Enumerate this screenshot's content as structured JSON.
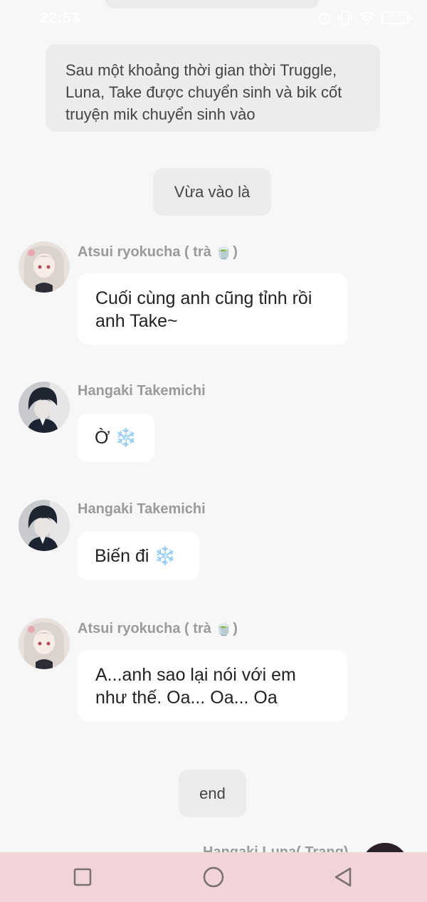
{
  "status_bar": {
    "time": "22:53",
    "icons": [
      "alarm-icon",
      "vibrate-icon",
      "wifi-icon",
      "battery-icon"
    ],
    "battery": "37"
  },
  "narrations": {
    "intro": "Sau một khoảng thời gian thời Truggle, Luna, Take được chuyển sinh và bik cốt truyện mik chuyển sinh vào",
    "scene": "Vừa vào là",
    "end": "end"
  },
  "messages": [
    {
      "sender": "Atsui ryokucha ( trà 🍵)",
      "text": "Cuối cùng anh cũng tỉnh rồi anh Take~",
      "avatar": "anime-girl-avatar"
    },
    {
      "sender": "Hangaki Takemichi",
      "text": "Ờ ❄️",
      "avatar": "anime-boy-avatar"
    },
    {
      "sender": "Hangaki Takemichi",
      "text": "Biến đi ❄️",
      "avatar": "anime-boy-avatar"
    },
    {
      "sender": "Atsui ryokucha ( trà 🍵)",
      "text": "A...anh sao lại nói với em như thế. Oa... Oa... Oa",
      "avatar": "anime-girl-avatar"
    }
  ],
  "peek_message": {
    "sender": "Hangaki Luna( Trang)"
  },
  "nav_bar": {
    "buttons": [
      "recent-apps",
      "home",
      "back"
    ],
    "background": "#f0d4d7"
  },
  "colors": {
    "page_background": "#f7f7f7",
    "narration_background": "#ececec",
    "bubble_background": "#ffffff",
    "sender_text": "#9a9a9a"
  }
}
